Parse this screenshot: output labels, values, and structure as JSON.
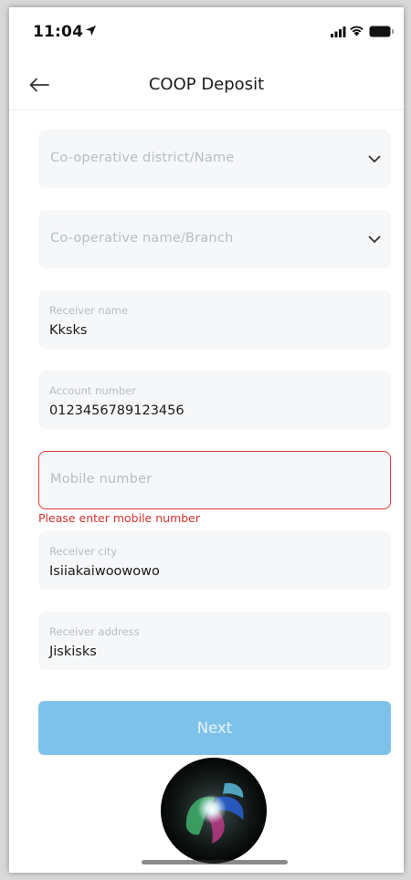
{
  "status_bar": {
    "time": "11:04"
  },
  "header": {
    "title": "COOP Deposit"
  },
  "form": {
    "district": {
      "placeholder": "Co-operative district/Name"
    },
    "branch": {
      "placeholder": "Co-operative name/Branch"
    },
    "receiver_name": {
      "label": "Receiver name",
      "value": "Kksks"
    },
    "account_number": {
      "label": "Account number",
      "value": "0123456789123456"
    },
    "mobile_number": {
      "placeholder": "Mobile number",
      "error": "Please enter mobile number"
    },
    "receiver_city": {
      "label": "Receiver city",
      "value": "Isiiakaiwoowowo"
    },
    "receiver_address": {
      "label": "Receiver address",
      "value": "Jiskisks"
    }
  },
  "actions": {
    "next_label": "Next"
  },
  "colors": {
    "accent": "#7fc2e9",
    "error": "#e0383a",
    "field_bg": "#f6f7f9"
  },
  "icons": [
    "location-arrow-icon",
    "signal-icon",
    "wifi-icon",
    "battery-icon",
    "back-arrow-icon",
    "chevron-down-icon",
    "siri-icon"
  ]
}
